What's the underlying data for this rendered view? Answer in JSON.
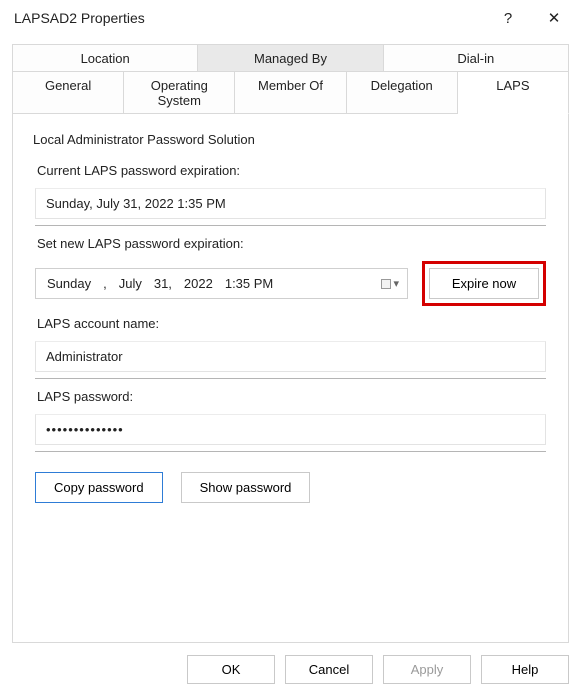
{
  "window": {
    "title": "LAPSAD2 Properties",
    "help_symbol": "?",
    "close_symbol": "✕"
  },
  "tabs": {
    "row1": [
      {
        "label": "Location"
      },
      {
        "label": "Managed By"
      },
      {
        "label": "Dial-in"
      }
    ],
    "row2": [
      {
        "label": "General"
      },
      {
        "label": "Operating System"
      },
      {
        "label": "Member Of"
      },
      {
        "label": "Delegation"
      },
      {
        "label": "LAPS",
        "active": true
      }
    ]
  },
  "laps": {
    "group_title": "Local Administrator Password Solution",
    "current_expiration_label": "Current LAPS password expiration:",
    "current_expiration_value": "Sunday, July 31, 2022 1:35 PM",
    "set_expiration_label": "Set new LAPS password expiration:",
    "datetime": {
      "weekday": "Sunday",
      "comma": ",",
      "month": "July",
      "day": "31,",
      "year": "2022",
      "time": "1:35 PM"
    },
    "expire_now": "Expire now",
    "account_name_label": "LAPS account name:",
    "account_name_value": "Administrator",
    "password_label": "LAPS password:",
    "password_masked": "••••••••••••••",
    "copy_password": "Copy password",
    "show_password": "Show password"
  },
  "footer": {
    "ok": "OK",
    "cancel": "Cancel",
    "apply": "Apply",
    "help": "Help"
  }
}
